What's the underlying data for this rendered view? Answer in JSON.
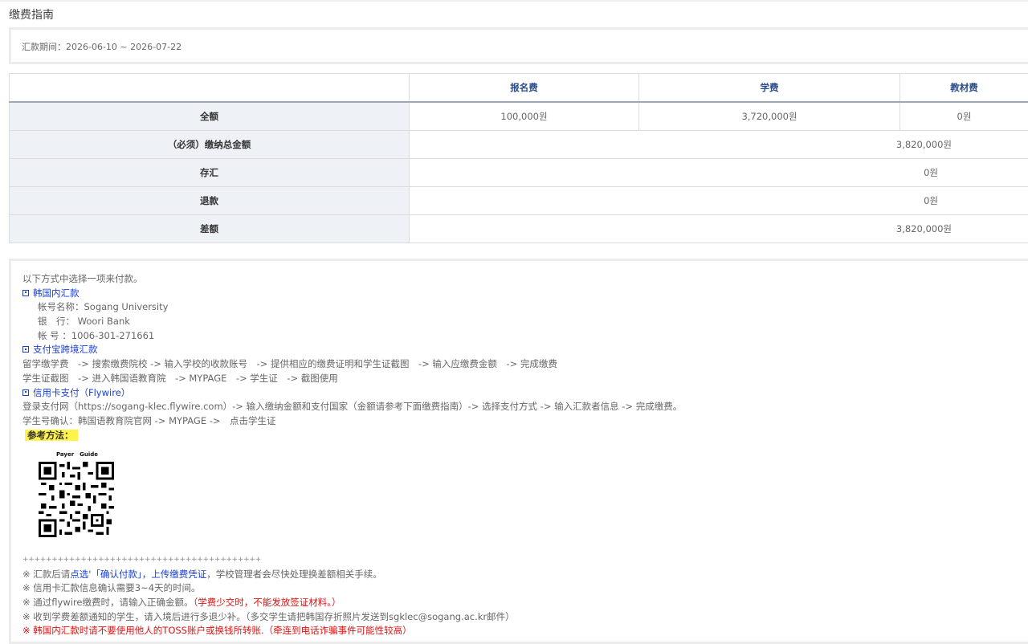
{
  "page_title": "缴费指南",
  "period": "汇款期间：2026-06-10 ~ 2026-07-22",
  "fee_table": {
    "headers": [
      "",
      "报名费",
      "学费",
      "教材费"
    ],
    "rows": [
      {
        "label": "全额",
        "values": [
          "100,000원",
          "3,720,000원",
          "0원"
        ]
      },
      {
        "label": "（必须）缴纳总金额",
        "value": "3,820,000원"
      },
      {
        "label": "存汇",
        "value": "0원"
      },
      {
        "label": "退款",
        "value": "0원"
      },
      {
        "label": "差额",
        "value": "3,820,000원"
      }
    ]
  },
  "guide": {
    "intro": "以下方式中选择一项来付款。",
    "korea_title": "韩国内汇款",
    "account_name": "帐号名称：Sogang University",
    "bank": "银　行： Woori Bank",
    "account_no": "帐 号 ：1006-301-271661",
    "alipay_title": "支付宝跨境汇款",
    "alipay_steps": "留学缴学费　-> 搜索缴费院校 -> 输入学校的收款账号　-> 提供相应的缴费证明和学生证截图　-> 输入应缴费金额　-> 完成缴费",
    "alipay_student": "学生证截图　-> 进入韩国语教育院　-> MYPAGE　-> 学生证　-> 截图使用",
    "flywire_title": "信用卡支付（Flywire）",
    "flywire_steps": "登录支付网（https://sogang-klec.flywire.com）-> 输入缴纳金额和支付国家（金额请参考下面缴费指南）-> 选择支付方式 -> 输入汇款者信息 -> 完成缴费。",
    "flywire_student": "学生号确认：韩国语教育院官网 -> MYPAGE ->　点击学生证",
    "reference_label": "参考方法：",
    "qr_title": "Payer　Guide",
    "divider": "+++++++++++++++++++++++++++++++++++++++++",
    "note1_a": "※ 汇款后请",
    "note1_b": "点选'「确认付款」，上传缴费凭证",
    "note1_c": "，学校管理者会尽快处理换差额相关手续。",
    "note2": "※ 信用卡汇款信息确认需要3~4天的时间。",
    "note3_a": "※ 通过flywire缴费时，请输入正确金额。",
    "note3_b": "（学费少交时，不能发放签证材料。）",
    "note4": "※ 收到学费差额通知的学生，请入境后进行多退少补。（多交学生请把韩国存折照片发送到sgklec@sogang.ac.kr邮件）",
    "note5": "※ 韩国内汇款时请不要使用他人的TOSS账户或换钱所转账.（牵连到电话诈骗事件可能性较高）"
  },
  "colors": {
    "accent_blue": "#1a3fd6",
    "warning_red": "#e01010",
    "highlight": "#fff34a"
  }
}
